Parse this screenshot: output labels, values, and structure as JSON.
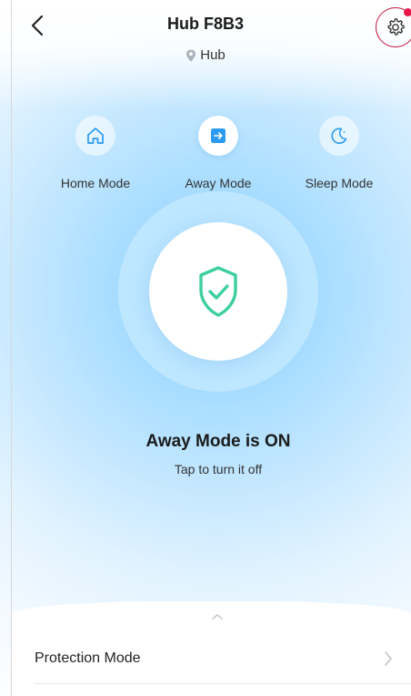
{
  "header": {
    "title": "Hub F8B3",
    "location": "Hub"
  },
  "modes": [
    {
      "label": "Home Mode",
      "icon": "home-icon",
      "active": false
    },
    {
      "label": "Away Mode",
      "icon": "away-icon",
      "active": true
    },
    {
      "label": "Sleep Mode",
      "icon": "moon-icon",
      "active": false
    }
  ],
  "status": {
    "title": "Away Mode is ON",
    "subtitle": "Tap to turn it off"
  },
  "list": {
    "items": [
      {
        "label": "Protection Mode"
      }
    ]
  },
  "colors": {
    "accent": "#2a9bf0",
    "shield": "#3ccf9c",
    "alert": "#e8174a"
  }
}
